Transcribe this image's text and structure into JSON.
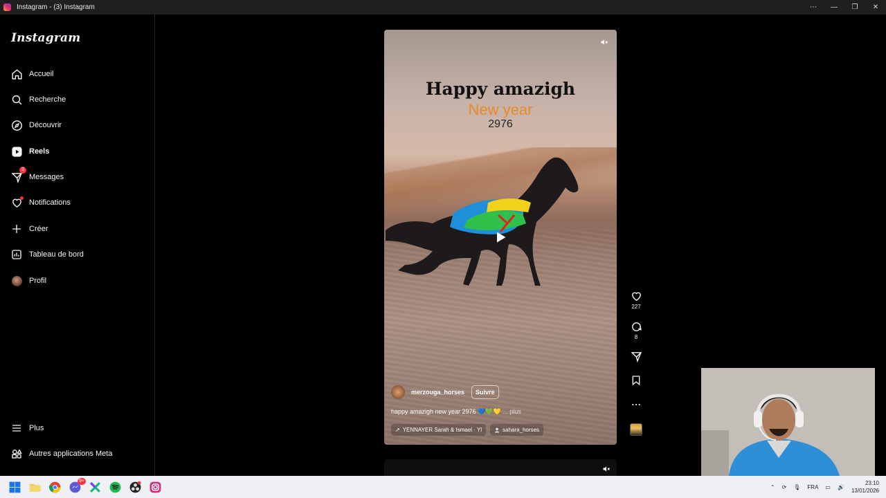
{
  "window": {
    "title": "Instagram - (3) Instagram",
    "controls": [
      "more-icon",
      "minimize-icon",
      "restore-icon",
      "close-icon"
    ]
  },
  "sidebar": {
    "logo": "Instagram",
    "items": [
      {
        "label": "Accueil",
        "icon": "home-icon"
      },
      {
        "label": "Recherche",
        "icon": "search-icon"
      },
      {
        "label": "Découvrir",
        "icon": "compass-icon"
      },
      {
        "label": "Reels",
        "icon": "reels-icon",
        "active": true
      },
      {
        "label": "Messages",
        "icon": "messenger-icon",
        "badge": "3"
      },
      {
        "label": "Notifications",
        "icon": "heart-icon",
        "dot": true
      },
      {
        "label": "Créer",
        "icon": "plus-icon"
      },
      {
        "label": "Tableau de bord",
        "icon": "dashboard-icon"
      },
      {
        "label": "Profil",
        "icon": "avatar"
      }
    ],
    "bottom_items": [
      {
        "label": "Plus",
        "icon": "menu-icon"
      },
      {
        "label": "Autres applications Meta",
        "icon": "meta-apps-icon"
      }
    ]
  },
  "reel": {
    "overlay_line1": "Happy amazigh",
    "overlay_line2": "New year",
    "overlay_line3": "2976",
    "username": "merzouga_horses",
    "follow_label": "Suivre",
    "caption": "happy amazigh new year 2976 💙💚💛",
    "caption_more": "... plus",
    "audio_label": "YENNAYER  Sarah & Ismael · Yl",
    "tagged_user": "sahara_horses",
    "likes": "227",
    "comments": "8"
  },
  "taskbar": {
    "language": "FRA",
    "time": "23:10",
    "date": "13/01/2026",
    "messenger_badge": "9+"
  },
  "colors": {
    "accent_red": "#ff3040",
    "orange_text": "#e88a2c"
  }
}
